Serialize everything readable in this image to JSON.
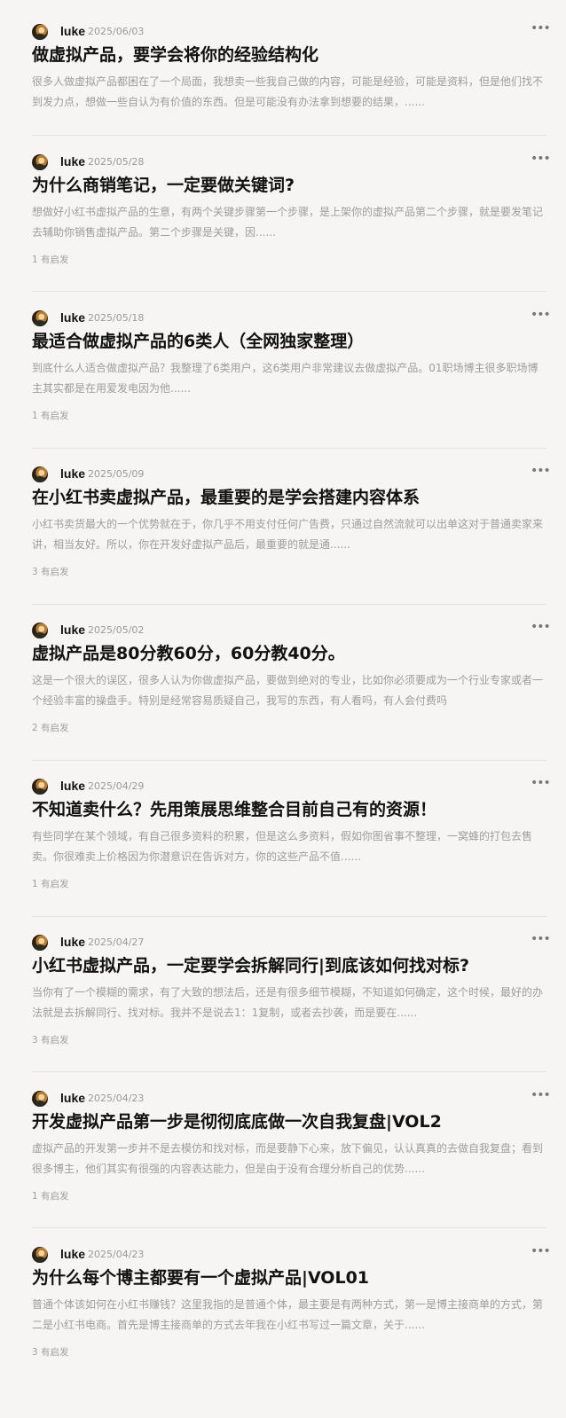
{
  "posts": [
    {
      "author": "luke",
      "date": "2025/06/03",
      "more": "•••",
      "title": "做虚拟产品，要学会将你的经验结构化",
      "excerpt": "很多人做虚拟产品都困在了一个局面，我想卖一些我自己做的内容，可能是经验，可能是资料，但是他们找不到发力点，想做一些自认为有价值的东西。但是可能没有办法拿到想要的结果，......",
      "likes": ""
    },
    {
      "author": "luke",
      "date": "2025/05/28",
      "more": "•••",
      "title": "为什么商销笔记，一定要做关键词?",
      "excerpt": "想做好小红书虚拟产品的生意，有两个关键步骤第一个步骤，是上架你的虚拟产品第二个步骤，就是要发笔记去辅助你销售虚拟产品。第二个步骤是关键，因......",
      "likes": "1 有启发"
    },
    {
      "author": "luke",
      "date": "2025/05/18",
      "more": "•••",
      "title": "最适合做虚拟产品的6类人（全网独家整理）",
      "excerpt": "到底什么人适合做虚拟产品？我整理了6类用户，这6类用户非常建议去做虚拟产品。01职场博主很多职场博主其实都是在用爱发电因为他......",
      "likes": "1 有启发"
    },
    {
      "author": "luke",
      "date": "2025/05/09",
      "more": "•••",
      "title": "在小红书卖虚拟产品，最重要的是学会搭建内容体系",
      "excerpt": "小红书卖货最大的一个优势就在于，你几乎不用支付任何广告费，只通过自然流就可以出单这对于普通卖家来讲，相当友好。所以，你在开发好虚拟产品后，最重要的就是通......",
      "likes": "3 有启发"
    },
    {
      "author": "luke",
      "date": "2025/05/02",
      "more": "•••",
      "title": "虚拟产品是80分教60分，60分教40分。",
      "excerpt": "这是一个很大的误区，很多人认为你做虚拟产品，要做到绝对的专业，比如你必须要成为一个行业专家或者一个经验丰富的操盘手。特别是经常容易质疑自己，我写的东西，有人看吗，有人会付费吗",
      "likes": "2 有启发"
    },
    {
      "author": "luke",
      "date": "2025/04/29",
      "more": "•••",
      "title": "不知道卖什么？先用策展思维整合目前自己有的资源！",
      "excerpt": "有些同学在某个领域，有自己很多资料的积累，但是这么多资料，假如你图省事不整理，一窝蜂的打包去售卖。你很难卖上价格因为你潜意识在告诉对方，你的这些产品不值......",
      "likes": "1 有启发"
    },
    {
      "author": "luke",
      "date": "2025/04/27",
      "more": "•••",
      "title": "小红书虚拟产品，一定要学会拆解同行|到底该如何找对标?",
      "excerpt": "当你有了一个模糊的需求，有了大致的想法后，还是有很多细节模糊，不知道如何确定，这个时候，最好的办法就是去拆解同行、找对标。我并不是说去1：1复制，或者去抄袭，而是要在......",
      "likes": "3 有启发"
    },
    {
      "author": "luke",
      "date": "2025/04/23",
      "more": "•••",
      "title": "开发虚拟产品第一步是彻彻底底做一次自我复盘|VOL2",
      "excerpt": "虚拟产品的开发第一步并不是去模仿和找对标，而是要静下心来，放下偏见，认认真真的去做自我复盘；看到很多博主，他们其实有很强的内容表达能力，但是由于没有合理分析自己的优势......",
      "likes": "1 有启发"
    },
    {
      "author": "luke",
      "date": "2025/04/23",
      "more": "•••",
      "title": "为什么每个博主都要有一个虚拟产品|VOL01",
      "excerpt": "普通个体该如何在小红书赚钱？这里我指的是普通个体，最主要是有两种方式，第一是博主接商单的方式，第二是小红书电商。首先是博主接商单的方式去年我在小红书写过一篇文章，关于......",
      "likes": "3 有启发"
    }
  ]
}
